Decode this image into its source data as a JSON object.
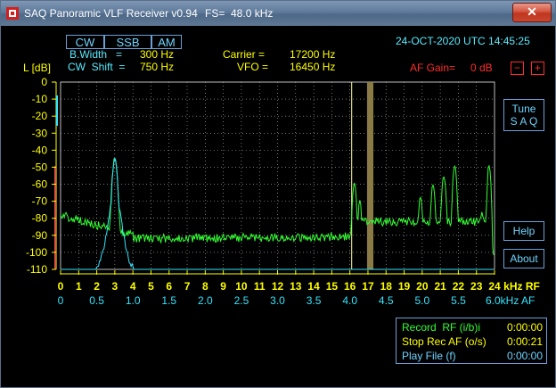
{
  "window": {
    "title": "SAQ Panoramic VLF Receiver v0.94",
    "fs": "FS=  48.0 kHz",
    "close_label": "✕"
  },
  "modes": [
    "CW",
    "SSB",
    "AM"
  ],
  "settings": {
    "bwidth_label": "B.Width   =",
    "bwidth_value": "300 Hz",
    "cwshift_label": "CW  Shift  =",
    "cwshift_value": "750 Hz",
    "carrier_label": "Carrier =",
    "carrier_value": "17200 Hz",
    "vfo_label": "VFO =",
    "vfo_value": "16450 Hz",
    "datetime": "24-OCT-2020 UTC 14:45:25",
    "af_gain_label": "AF Gain=",
    "af_gain_value": "0 dB",
    "gain_minus": "−",
    "gain_plus": "+"
  },
  "buttons": {
    "tune_line1": "Tune",
    "tune_line2": "S A Q",
    "help": "Help",
    "about": "About"
  },
  "spectrum": {
    "y_axis_title": "L [dB]",
    "y_ticks": [
      "0",
      "-10",
      "-20",
      "-30",
      "-40",
      "-50",
      "-60",
      "-70",
      "-80",
      "-90",
      "-100",
      "-110"
    ],
    "rf_ticks": [
      "0",
      "1",
      "2",
      "3",
      "4",
      "5",
      "6",
      "7",
      "8",
      "9",
      "10",
      "11",
      "12",
      "13",
      "14",
      "15",
      "16",
      "17",
      "18",
      "19",
      "20",
      "21",
      "22",
      "23",
      "24"
    ],
    "rf_unit": "kHz RF",
    "af_ticks": [
      "0",
      "0.5",
      "1.0",
      "1.5",
      "2.0",
      "2.5",
      "3.0",
      "3.5",
      "4.0",
      "4.5",
      "5.0",
      "5.5"
    ],
    "af_unit": "6.0kHz AF",
    "colors": {
      "rf_trace": "#33ff33",
      "af_trace": "#33e5ff",
      "grid": "#bdbdbd",
      "axis": "#ffff00",
      "marker": "#ffff99",
      "band": "#8a7a45"
    }
  },
  "status": {
    "record_label": "Record  RF (i/b)i",
    "record_value": "0:00:00",
    "stop_label": "Stop Rec AF (o/s)",
    "stop_value": "0:00:21",
    "play_label": "Play File (f)",
    "play_value": "0:00:00"
  }
}
